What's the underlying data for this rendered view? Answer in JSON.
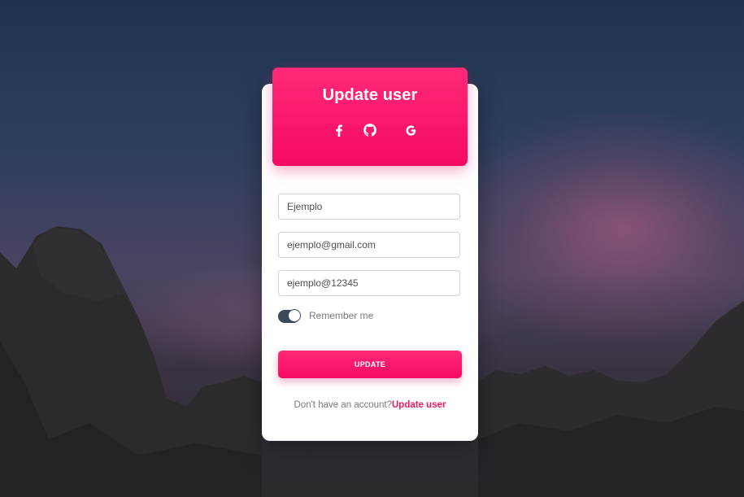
{
  "card": {
    "title": "Update user",
    "social": [
      {
        "icon": "facebook-icon"
      },
      {
        "icon": "github-icon"
      },
      {
        "icon": "google-icon"
      }
    ]
  },
  "form": {
    "name_value": "Ejemplo",
    "email_value": "ejemplo@gmail.com",
    "password_value": "ejemplo@12345",
    "remember_label": "Remember me",
    "remember_on": true,
    "submit_label": "UPDATE"
  },
  "footer": {
    "prompt": "Don't have an account?",
    "link": "Update user"
  },
  "colors": {
    "accent": "#f50a62",
    "toggle": "#3c4858"
  }
}
